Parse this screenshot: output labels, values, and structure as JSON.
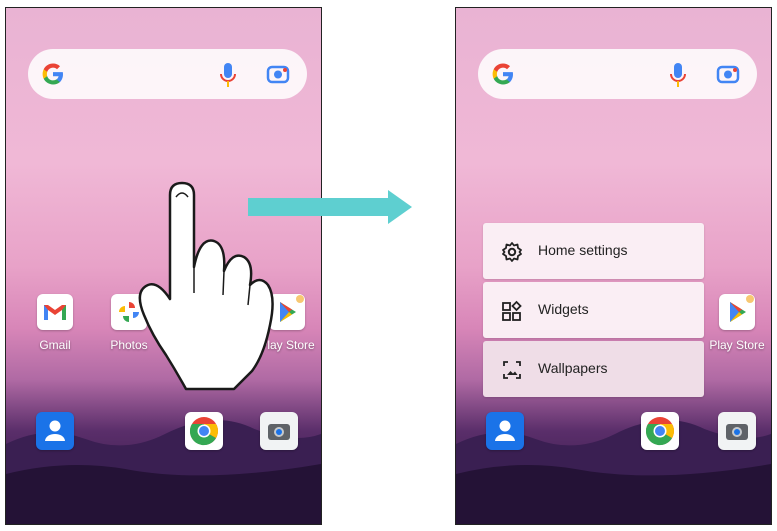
{
  "left_screen": {
    "apps": [
      {
        "label": "Gmail",
        "icon": "gmail-icon"
      },
      {
        "label": "Photos",
        "icon": "photos-icon"
      },
      {
        "label": "Play Store",
        "icon": "play-store-icon"
      }
    ],
    "dock": [
      {
        "icon": "contacts-icon"
      },
      {
        "icon": "chrome-icon"
      },
      {
        "icon": "camera-icon"
      }
    ]
  },
  "right_screen": {
    "menu": [
      {
        "label": "Home settings",
        "icon": "gear-icon"
      },
      {
        "label": "Widgets",
        "icon": "widgets-icon"
      },
      {
        "label": "Wallpapers",
        "icon": "wallpaper-icon"
      }
    ],
    "apps": [
      {
        "label": "Play Store",
        "icon": "play-store-icon"
      }
    ]
  },
  "colors": {
    "arrow": "#5ecfd0",
    "accent_blue": "#1a73e8"
  }
}
